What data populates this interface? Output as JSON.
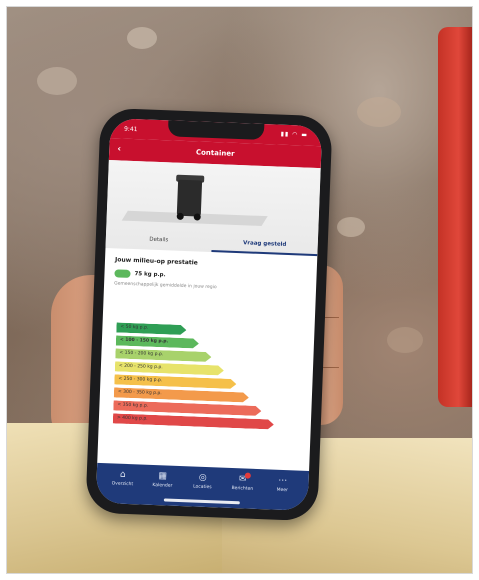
{
  "colors": {
    "brand_red": "#c8102e",
    "nav_blue": "#1f3a7a",
    "active_green": "#5cb85c"
  },
  "status": {
    "time": "9:41",
    "icons": "▮▮ ◠ ▬"
  },
  "header": {
    "title": "Container",
    "back_icon": "chevron-left-icon"
  },
  "tabs": [
    {
      "label": "Details",
      "active": false
    },
    {
      "label": "Vraag gesteld",
      "active": true
    }
  ],
  "content": {
    "title": "Jouw milieu-op prestatie",
    "value": "75 kg p.p.",
    "note": "Gemeenschappelijk gemiddelde in jouw regio"
  },
  "scale": [
    {
      "label": "< 50 kg p.p.",
      "color": "#2f9e55",
      "active": false
    },
    {
      "label": "< 100 - 150 kg p.p.",
      "color": "#5cb85c",
      "active": true
    },
    {
      "label": "< 150 - 200 kg p.p.",
      "color": "#a8d26b",
      "active": false
    },
    {
      "label": "< 200 - 250 kg p.p.",
      "color": "#e7e36b",
      "active": false
    },
    {
      "label": "< 250 - 300 kg p.p.",
      "color": "#f5c04a",
      "active": false
    },
    {
      "label": "< 300 - 350 kg p.p.",
      "color": "#f39a4b",
      "active": false
    },
    {
      "label": "< 350 kg p.p.",
      "color": "#ec6b5a",
      "active": false
    },
    {
      "label": "> 400 kg p.p.",
      "color": "#e04848",
      "active": false
    }
  ],
  "tabbar": [
    {
      "label": "Overzicht",
      "icon": "home-icon",
      "glyph": "⌂"
    },
    {
      "label": "Kalender",
      "icon": "calendar-icon",
      "glyph": "▦"
    },
    {
      "label": "Locaties",
      "icon": "location-icon",
      "glyph": "◎"
    },
    {
      "label": "Berichten",
      "icon": "bell-icon",
      "glyph": "✉",
      "badge": true
    },
    {
      "label": "Meer",
      "icon": "more-icon",
      "glyph": "⋯"
    }
  ]
}
